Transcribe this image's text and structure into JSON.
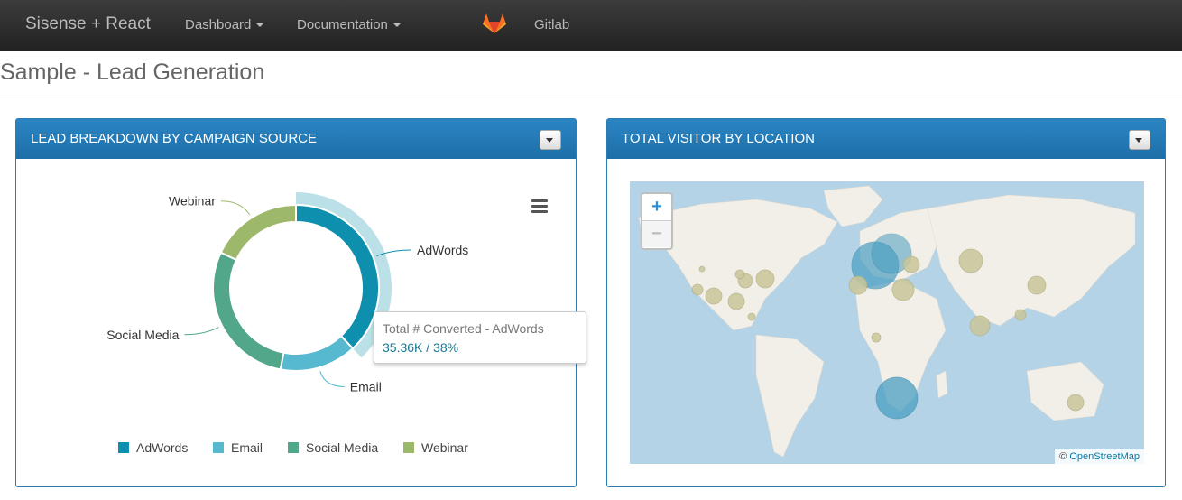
{
  "nav": {
    "brand": "Sisense + React",
    "items": [
      {
        "label": "Dashboard",
        "has_dropdown": true
      },
      {
        "label": "Documentation",
        "has_dropdown": true
      },
      {
        "label": "Gitlab",
        "icon": "gitlab-icon"
      }
    ]
  },
  "page": {
    "title": "Sample - Lead Generation"
  },
  "widgets": {
    "left": {
      "title": "LEAD BREAKDOWN BY CAMPAIGN SOURCE",
      "icon": "hamburger-menu-icon"
    },
    "right": {
      "title": "TOTAL VISITOR BY LOCATION"
    }
  },
  "chart_data": {
    "type": "pie",
    "style": "donut",
    "categories": [
      "AdWords",
      "Email",
      "Social Media",
      "Webinar"
    ],
    "values": [
      38,
      15,
      29,
      18
    ],
    "colors": [
      "#0f8fae",
      "#56b9cf",
      "#52a68a",
      "#9db86a"
    ],
    "hover_highlight": "AdWords",
    "legend": "bottom",
    "tooltip": {
      "title": "Total # Converted  -  AdWords",
      "value": "35.36K / 38%"
    }
  },
  "map": {
    "zoom_in": "+",
    "zoom_out": "−",
    "attribution_prefix": "©",
    "attribution_link": "OpenStreetMap",
    "colors": {
      "water": "#b5d3e7",
      "land": "#f2efe9",
      "bubble_large": "#4a9fc2",
      "bubble_small": "#c9c79a"
    }
  },
  "colors": {
    "navbar": "#2a2a2a",
    "panel_header": "#2279b6"
  }
}
